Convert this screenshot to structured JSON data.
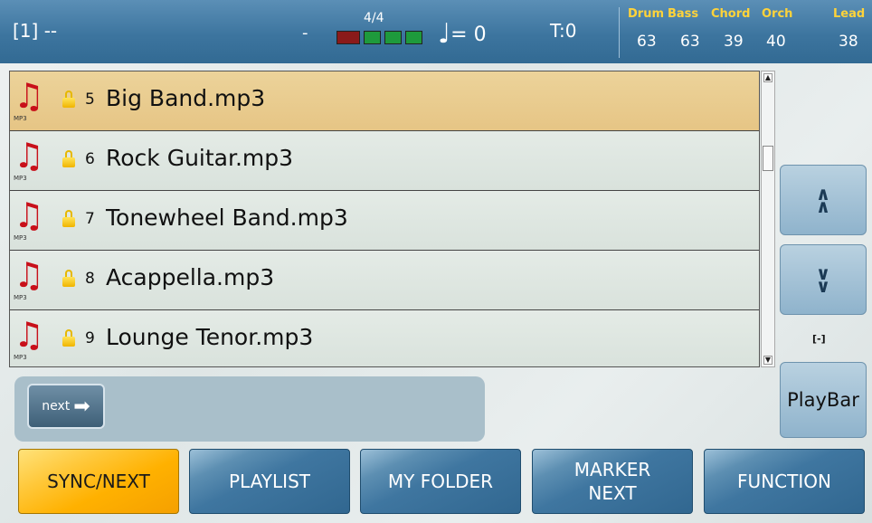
{
  "header": {
    "slot_name": "[1] --",
    "slot_dash": "-",
    "time_signature": "4/4",
    "tempo_value": "= 0",
    "transpose": "T:0",
    "volumes": [
      {
        "label": "Drum",
        "value": "63"
      },
      {
        "label": "Bass",
        "value": "63"
      },
      {
        "label": "Chord",
        "value": "39"
      },
      {
        "label": "Orch",
        "value": "40"
      },
      {
        "label": "Lead",
        "value": "38"
      }
    ]
  },
  "files": [
    {
      "num": "5",
      "name": "Big Band.mp3",
      "type": "MP3"
    },
    {
      "num": "6",
      "name": "Rock Guitar.mp3",
      "type": "MP3"
    },
    {
      "num": "7",
      "name": "Tonewheel Band.mp3",
      "type": "MP3"
    },
    {
      "num": "8",
      "name": "Acappella.mp3",
      "type": "MP3"
    },
    {
      "num": "9",
      "name": "Lounge Tenor.mp3",
      "type": "MP3"
    }
  ],
  "side": {
    "page_indicator": "[-]",
    "playbar_label": "PlayBar"
  },
  "next_button_label": "next",
  "tabs": [
    {
      "label": "SYNC/NEXT"
    },
    {
      "label": "PLAYLIST"
    },
    {
      "label": "MY FOLDER"
    },
    {
      "label": "MARKER NEXT"
    },
    {
      "label": "FUNCTION"
    }
  ],
  "colors": {
    "header_bg": "#3d759f",
    "selected_row": "#e6c585",
    "active_tab": "#ffb100",
    "volume_labels": "#ffd33a"
  }
}
